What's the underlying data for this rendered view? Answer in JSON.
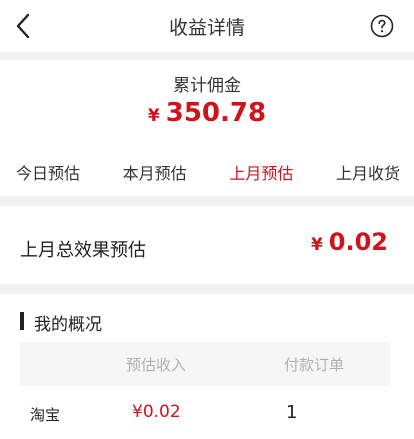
{
  "header": {
    "title": "收益详情",
    "back_icon": "back-chevron-icon",
    "help_icon": "question-circle-icon"
  },
  "summary": {
    "label": "累计佣金",
    "currency": "¥",
    "amount": "350.78"
  },
  "tabs": [
    {
      "label": "今日预估",
      "active": false
    },
    {
      "label": "本月预估",
      "active": false
    },
    {
      "label": "上月预估",
      "active": true
    },
    {
      "label": "上月收货",
      "active": false
    }
  ],
  "estimate": {
    "label": "上月总效果预估",
    "currency": "¥",
    "amount": "0.02"
  },
  "overview": {
    "title": "我的概况",
    "columns": [
      "",
      "预估收入",
      "付款订单"
    ],
    "rows": [
      {
        "platform": "淘宝",
        "income": "¥0.02",
        "orders": "1"
      }
    ]
  },
  "colors": {
    "accent": "#d0121b",
    "background": "#f2f2f2",
    "muted_text": "#b0b0b0"
  }
}
